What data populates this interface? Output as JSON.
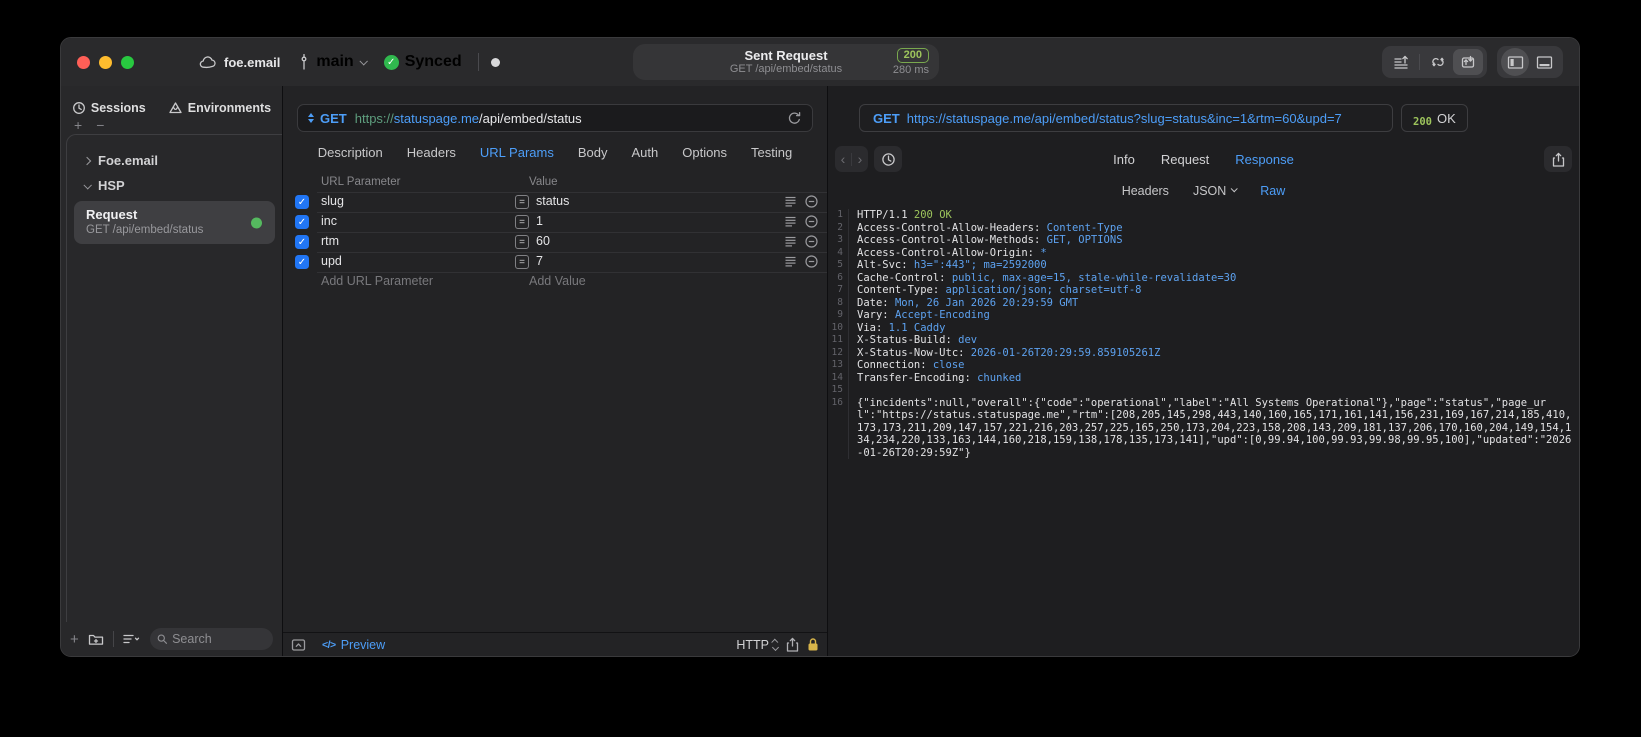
{
  "titlebar": {
    "project_name": "foe.email",
    "branch_name": "main",
    "sync_label": "Synced",
    "request_pill": {
      "title": "Sent Request",
      "subtitle": "GET /api/embed/status",
      "status_code": "200",
      "duration": "280 ms"
    }
  },
  "sidebar": {
    "tab_sessions": "Sessions",
    "tab_environments": "Environments",
    "add_label": "+",
    "remove_label": "−",
    "tree_items": [
      {
        "label": "Foe.email",
        "expanded": false
      },
      {
        "label": "HSP",
        "expanded": true
      }
    ],
    "request_item": {
      "title": "Request",
      "subtitle": "GET /api/embed/status"
    },
    "search_placeholder": "Search"
  },
  "request_editor": {
    "method": "GET",
    "url": {
      "scheme": "https://",
      "host": "statuspage.me",
      "path": "/api/embed/status"
    },
    "tabs": [
      "Description",
      "Headers",
      "URL Params",
      "Body",
      "Auth",
      "Options",
      "Testing"
    ],
    "active_tab": "URL Params",
    "params": {
      "col_name": "URL Parameter",
      "col_value": "Value",
      "rows": [
        {
          "enabled": true,
          "name": "slug",
          "value": "status"
        },
        {
          "enabled": true,
          "name": "inc",
          "value": "1"
        },
        {
          "enabled": true,
          "name": "rtm",
          "value": "60"
        },
        {
          "enabled": true,
          "name": "upd",
          "value": "7"
        }
      ],
      "add_name_placeholder": "Add URL Parameter",
      "add_value_placeholder": "Add Value"
    },
    "footer": {
      "code_glyph": "</>",
      "preview": "Preview",
      "protocol": "HTTP"
    }
  },
  "response_viewer": {
    "method": "GET",
    "url": "https://statuspage.me/api/embed/status?slug=status&inc=1&rtm=60&upd=7",
    "status_code": "200",
    "status_text": "OK",
    "tabs": [
      "Info",
      "Request",
      "Response"
    ],
    "active_tab": "Response",
    "subtabs": [
      "Headers",
      "JSON",
      "Raw"
    ],
    "active_subtab": "Raw",
    "raw": {
      "status_line": {
        "protocol": "HTTP/1.1",
        "status": "200 OK"
      },
      "headers": [
        [
          "Access-Control-Allow-Headers",
          "Content-Type"
        ],
        [
          "Access-Control-Allow-Methods",
          "GET, OPTIONS"
        ],
        [
          "Access-Control-Allow-Origin",
          "*"
        ],
        [
          "Alt-Svc",
          "h3=\":443\"; ma=2592000"
        ],
        [
          "Cache-Control",
          "public, max-age=15, stale-while-revalidate=30"
        ],
        [
          "Content-Type",
          "application/json; charset=utf-8"
        ],
        [
          "Date",
          "Mon, 26 Jan 2026 20:29:59 GMT"
        ],
        [
          "Vary",
          "Accept-Encoding"
        ],
        [
          "Via",
          "1.1 Caddy"
        ],
        [
          "X-Status-Build",
          "dev"
        ],
        [
          "X-Status-Now-Utc",
          "2026-01-26T20:29:59.859105261Z"
        ],
        [
          "Connection",
          "close"
        ],
        [
          "Transfer-Encoding",
          "chunked"
        ]
      ],
      "body": "{\"incidents\":null,\"overall\":{\"code\":\"operational\",\"label\":\"All Systems Operational\"},\"page\":\"status\",\"page_url\":\"https://status.statuspage.me\",\"rtm\":[208,205,145,298,443,140,160,165,171,161,141,156,231,169,167,214,185,410,173,173,211,209,147,157,221,216,203,257,225,165,250,173,204,223,158,208,143,209,181,137,206,170,160,204,149,154,134,234,220,133,163,144,160,218,159,138,178,135,173,141],\"upd\":[0,99.94,100,99.93,99.98,99.95,100],\"updated\":\"2026-01-26T20:29:59Z\"}"
    }
  },
  "colors": {
    "accent_blue": "#4d9ef8",
    "value_blue": "#5da2f0",
    "status_green": "#9dc45c",
    "checkbox_blue": "#2176f5",
    "synced_green": "#30b84e",
    "lock_gold": "#d8b54a"
  }
}
